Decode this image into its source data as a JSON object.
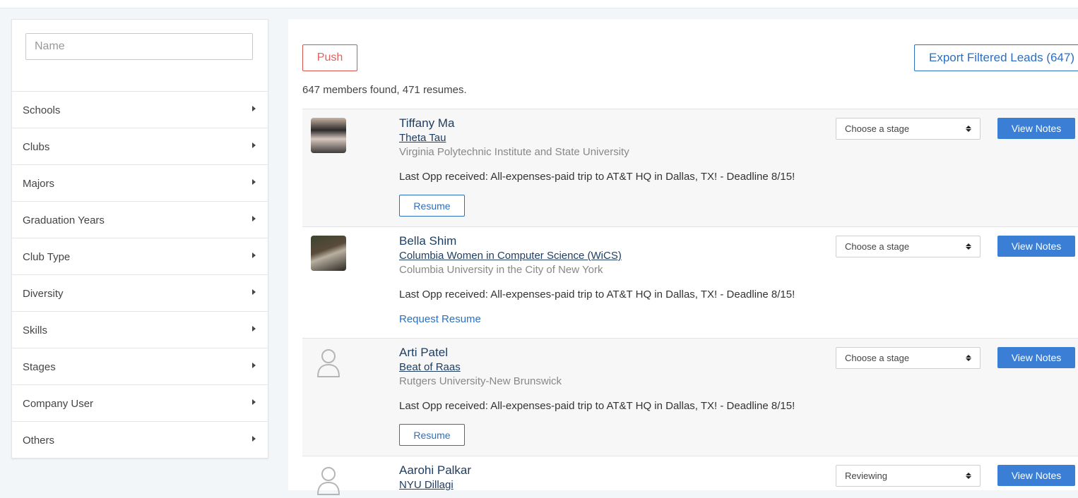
{
  "sidebar": {
    "name_placeholder": "Name",
    "filters": [
      {
        "label": "Schools"
      },
      {
        "label": "Clubs"
      },
      {
        "label": "Majors"
      },
      {
        "label": "Graduation Years"
      },
      {
        "label": "Club Type"
      },
      {
        "label": "Diversity"
      },
      {
        "label": "Skills"
      },
      {
        "label": "Stages"
      },
      {
        "label": "Company User"
      },
      {
        "label": "Others"
      }
    ]
  },
  "toolbar": {
    "push_label": "Push",
    "export_label": "Export Filtered Leads (647)"
  },
  "summary": "647 members found, 471 resumes.",
  "members": [
    {
      "name": "Tiffany Ma",
      "club": "Theta Tau",
      "school": "Virginia Polytechnic Institute and State University",
      "last_opp": "Last Opp received: All-expenses-paid trip to AT&T HQ in Dallas, TX! - Deadline 8/15!",
      "resume_action": "Resume",
      "stage": "Choose a stage",
      "notes_label": "View Notes"
    },
    {
      "name": "Bella Shim",
      "club": "Columbia Women in Computer Science (WiCS)",
      "school": "Columbia University in the City of New York",
      "last_opp": "Last Opp received: All-expenses-paid trip to AT&T HQ in Dallas, TX! - Deadline 8/15!",
      "resume_action": "Request Resume",
      "stage": "Choose a stage",
      "notes_label": "View Notes"
    },
    {
      "name": "Arti Patel",
      "club": "Beat of Raas",
      "school": "Rutgers University-New Brunswick",
      "last_opp": "Last Opp received: All-expenses-paid trip to AT&T HQ in Dallas, TX! - Deadline 8/15!",
      "resume_action": "Resume",
      "stage": "Choose a stage",
      "notes_label": "View Notes"
    },
    {
      "name": "Aarohi Palkar",
      "club": "NYU Dillagi",
      "stage": "Reviewing",
      "notes_label": "View Notes"
    }
  ]
}
